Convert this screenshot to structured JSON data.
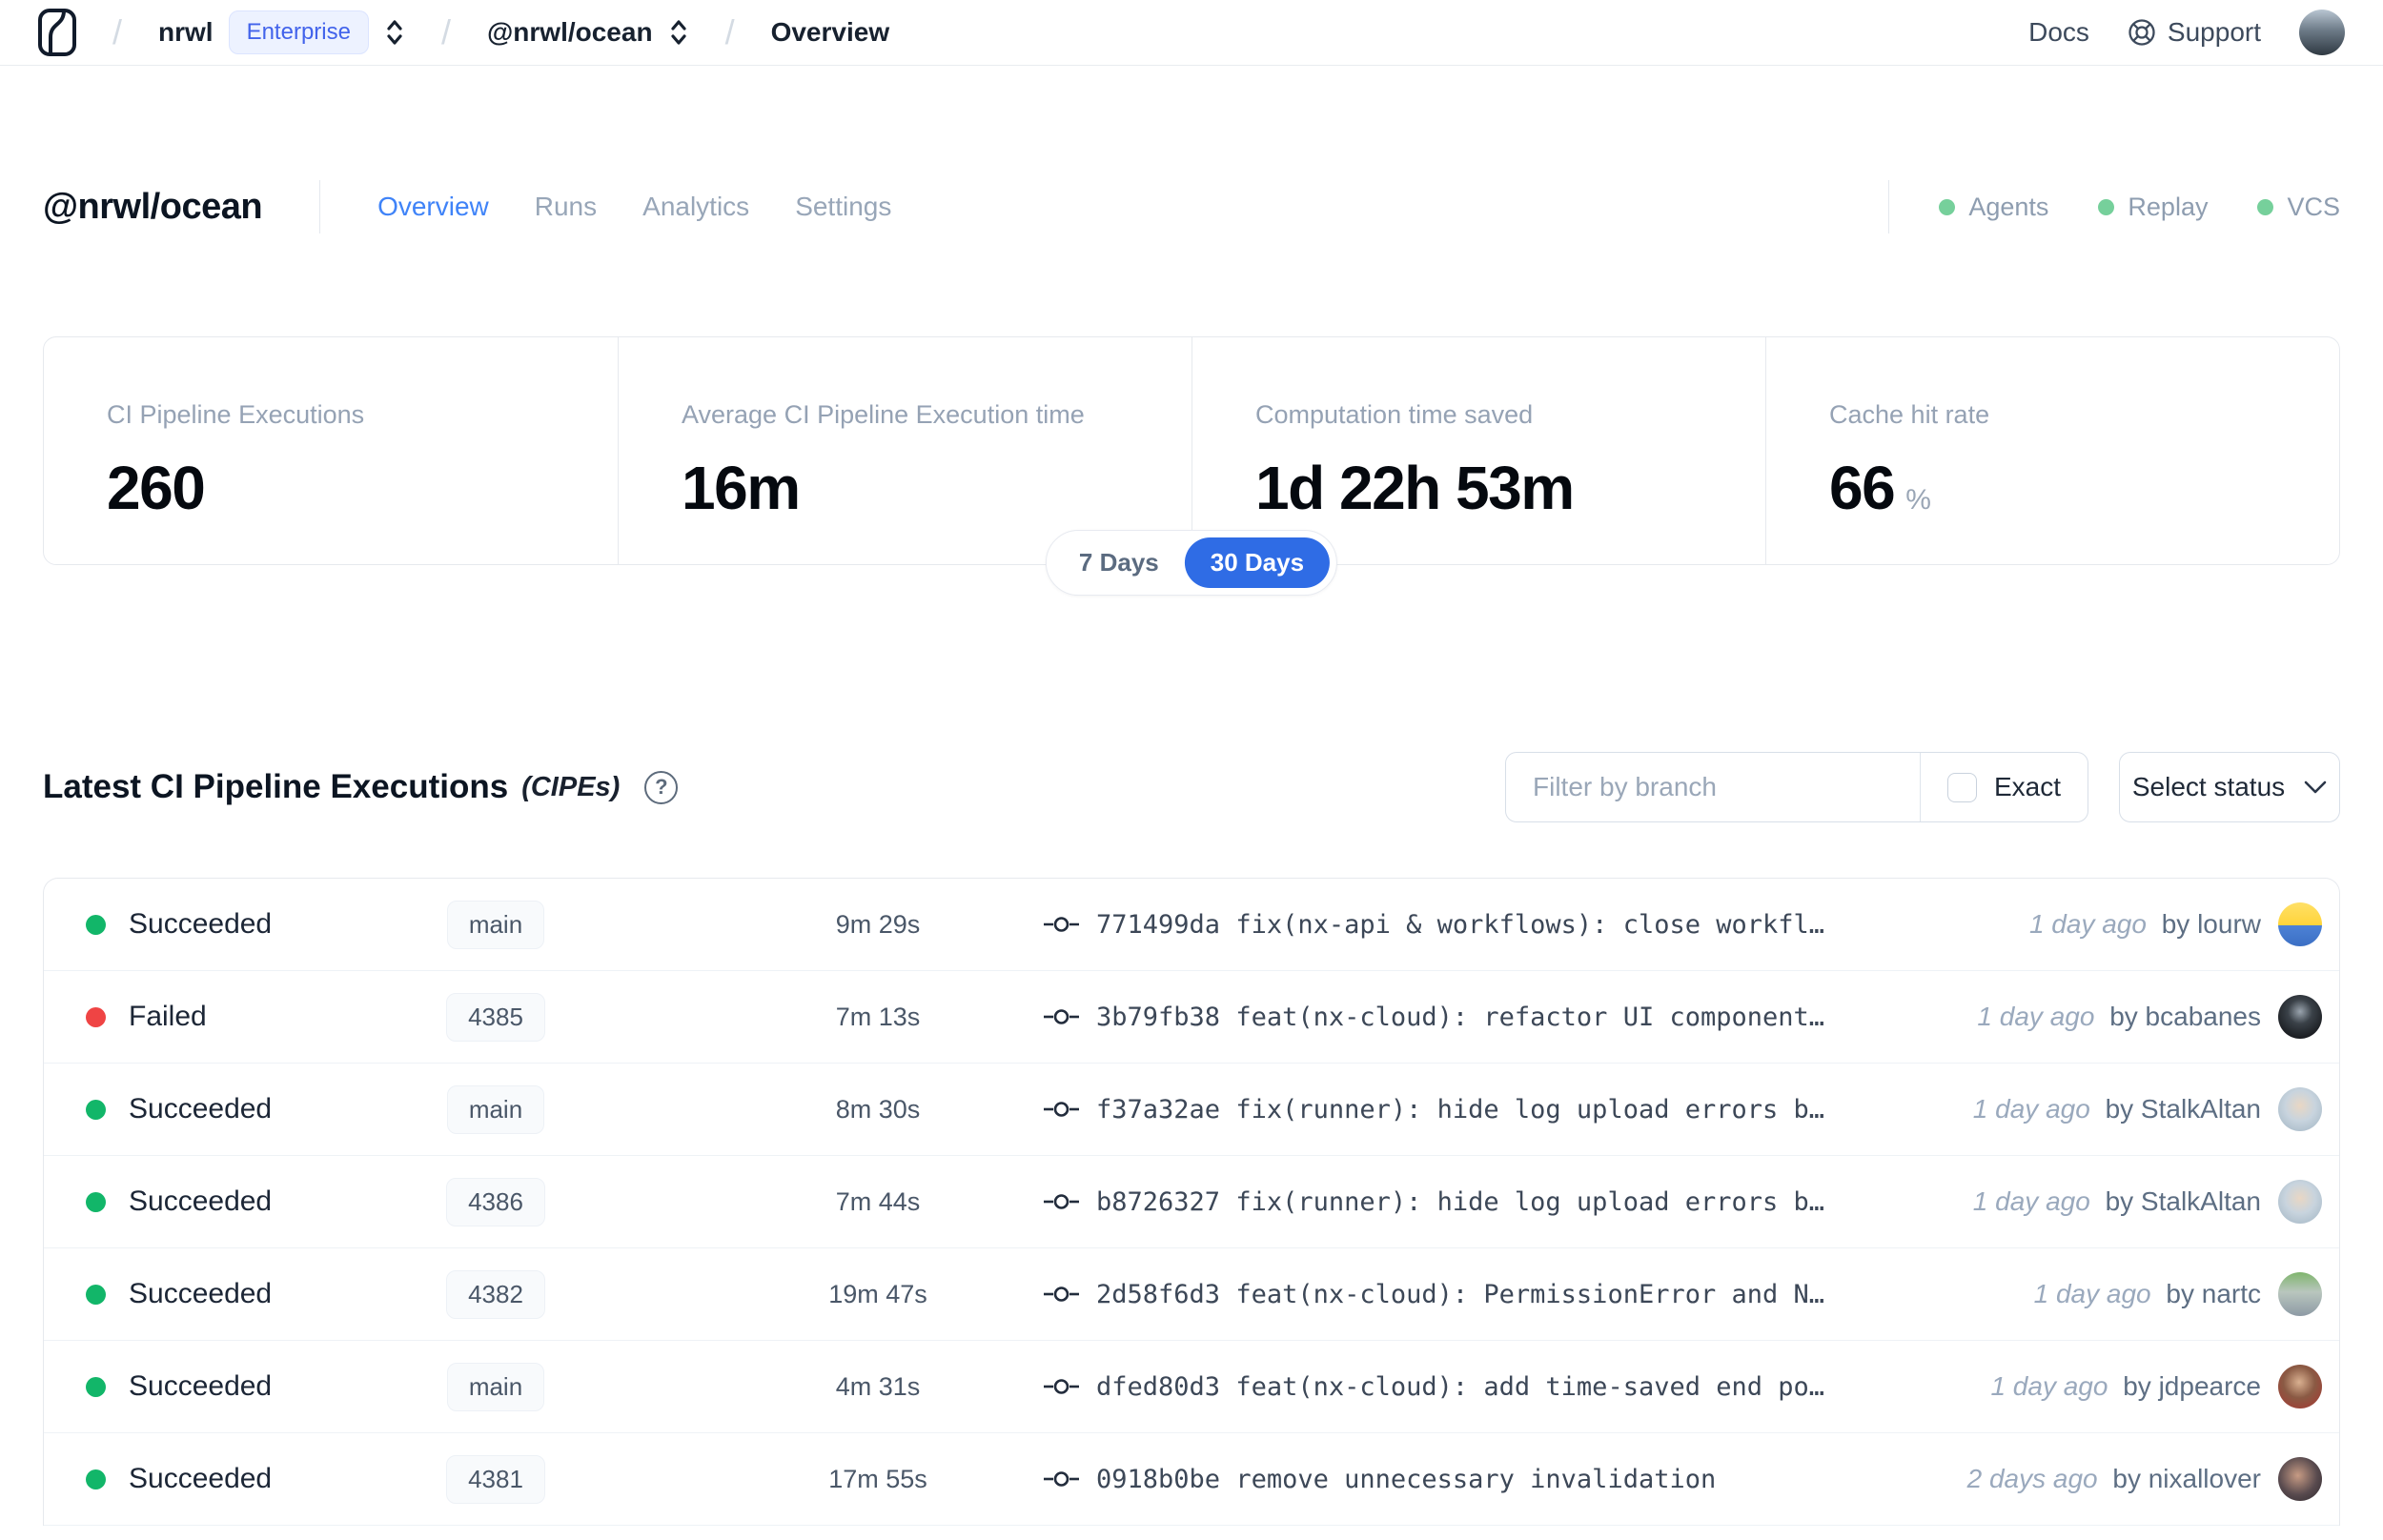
{
  "navbar": {
    "separator": "/",
    "org": "nrwl",
    "org_badge": "Enterprise",
    "workspace": "@nrwl/ocean",
    "page": "Overview",
    "docs_label": "Docs",
    "support_label": "Support"
  },
  "header": {
    "title": "@nrwl/ocean",
    "tabs": [
      {
        "label": "Overview",
        "active": true
      },
      {
        "label": "Runs",
        "active": false
      },
      {
        "label": "Analytics",
        "active": false
      },
      {
        "label": "Settings",
        "active": false
      }
    ],
    "features": [
      {
        "label": "Agents"
      },
      {
        "label": "Replay"
      },
      {
        "label": "VCS"
      }
    ]
  },
  "stats": {
    "cards": [
      {
        "label": "CI Pipeline Executions",
        "value": "260",
        "suffix": ""
      },
      {
        "label": "Average CI Pipeline Execution time",
        "value": "16m",
        "suffix": ""
      },
      {
        "label": "Computation time saved",
        "value": "1d 22h 53m",
        "suffix": ""
      },
      {
        "label": "Cache hit rate",
        "value": "66",
        "suffix": "%"
      }
    ],
    "range": {
      "inactive": "7 Days",
      "active": "30 Days"
    }
  },
  "cipes": {
    "title": "Latest CI Pipeline Executions",
    "title_abbr": "(CIPEs)",
    "help_glyph": "?",
    "filter_placeholder": "Filter by branch",
    "exact_label": "Exact",
    "status_button": "Select status",
    "rows": [
      {
        "status": "Succeeded",
        "branch": "main",
        "duration": "9m 29s",
        "commit_hash": "771499da",
        "commit_message": "fix(nx-api & workflows): close workfl…",
        "time": "1 day ago",
        "author": "by lourw",
        "avatar": "lourw"
      },
      {
        "status": "Failed",
        "branch": "4385",
        "duration": "7m 13s",
        "commit_hash": "3b79fb38",
        "commit_message": "feat(nx-cloud): refactor UI component…",
        "time": "1 day ago",
        "author": "by bcabanes",
        "avatar": "bcabanes"
      },
      {
        "status": "Succeeded",
        "branch": "main",
        "duration": "8m 30s",
        "commit_hash": "f37a32ae",
        "commit_message": "fix(runner): hide log upload errors b…",
        "time": "1 day ago",
        "author": "by StalkAltan",
        "avatar": "stalkaltan"
      },
      {
        "status": "Succeeded",
        "branch": "4386",
        "duration": "7m 44s",
        "commit_hash": "b8726327",
        "commit_message": "fix(runner): hide log upload errors b…",
        "time": "1 day ago",
        "author": "by StalkAltan",
        "avatar": "stalkaltan"
      },
      {
        "status": "Succeeded",
        "branch": "4382",
        "duration": "19m 47s",
        "commit_hash": "2d58f6d3",
        "commit_message": "feat(nx-cloud): PermissionError and N…",
        "time": "1 day ago",
        "author": "by nartc",
        "avatar": "nartc"
      },
      {
        "status": "Succeeded",
        "branch": "main",
        "duration": "4m 31s",
        "commit_hash": "dfed80d3",
        "commit_message": "feat(nx-cloud): add time-saved end po…",
        "time": "1 day ago",
        "author": "by jdpearce",
        "avatar": "jdpearce"
      },
      {
        "status": "Succeeded",
        "branch": "4381",
        "duration": "17m 55s",
        "commit_hash": "0918b0be",
        "commit_message": "remove unnecessary invalidation",
        "time": "2 days ago",
        "author": "by nixallover",
        "avatar": "nixallover"
      }
    ]
  },
  "colors": {
    "accent_blue": "#2f6ce5",
    "active_tab_blue": "#3f83f8",
    "success_green": "#12b669",
    "failed_red": "#ef4444",
    "feature_dot_green": "#76d09b",
    "enterprise_blue": "#4263eb"
  }
}
